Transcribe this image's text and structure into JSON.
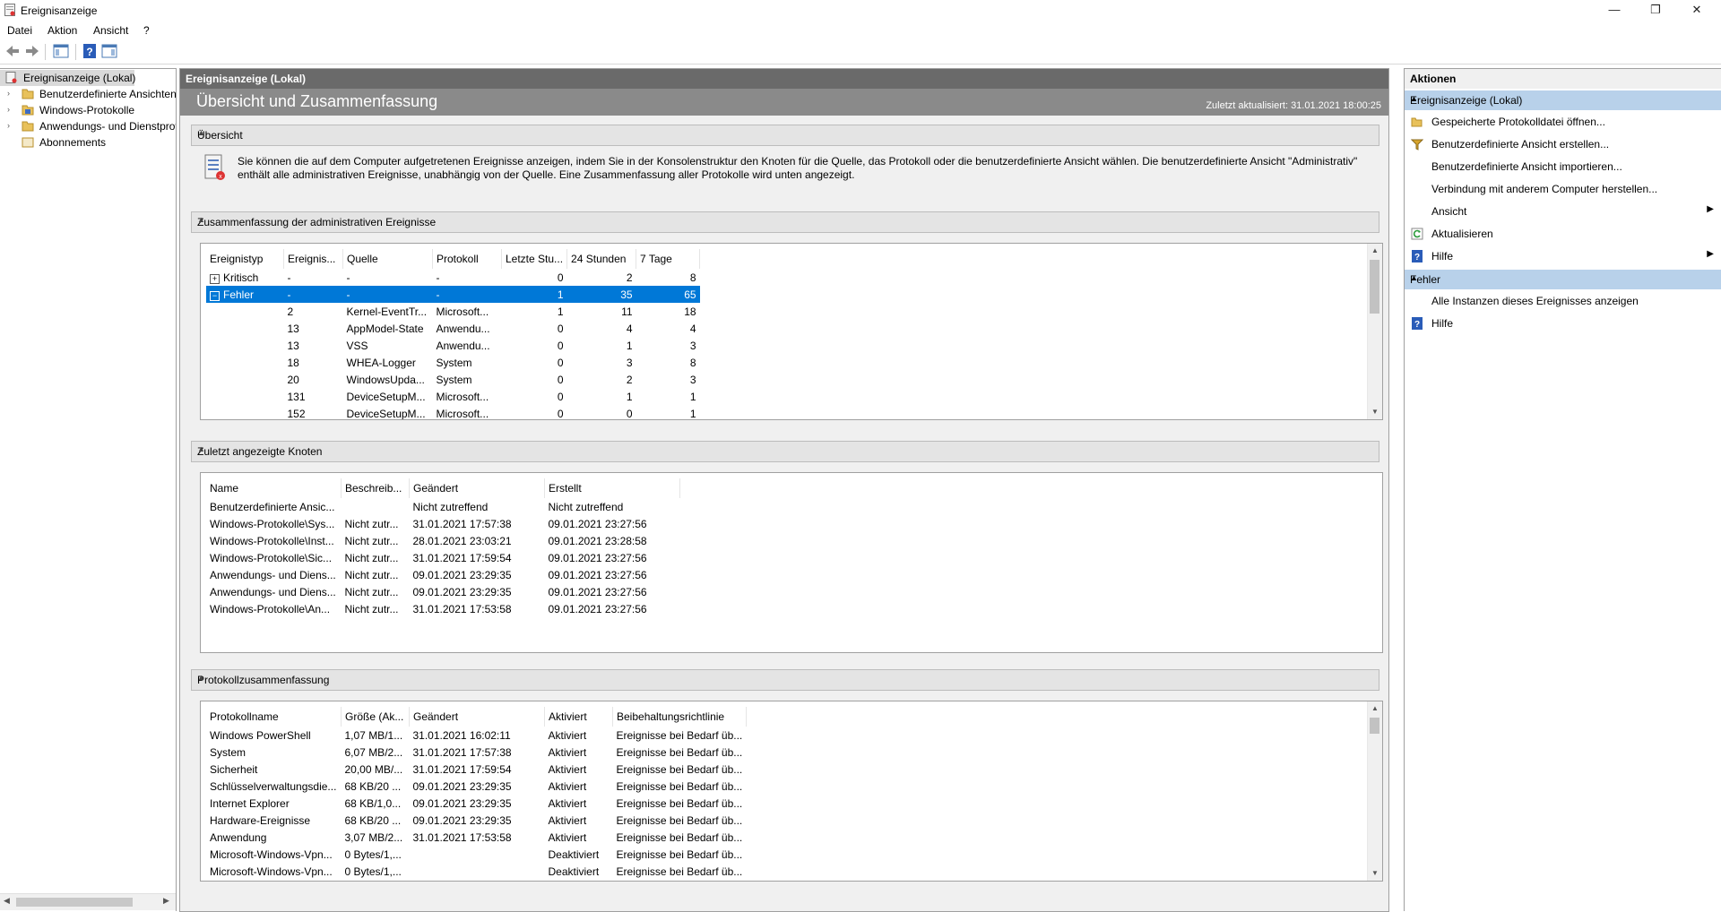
{
  "window": {
    "title": "Ereignisanzeige",
    "minimize": "—",
    "maximize": "❐",
    "close": "✕"
  },
  "menu": [
    "Datei",
    "Aktion",
    "Ansicht",
    "?"
  ],
  "toolbar": {
    "icons": [
      "back-arrow-icon",
      "forward-arrow-icon",
      "show-hide-tree-icon",
      "help-icon",
      "show-hide-action-pane-icon"
    ]
  },
  "tree": {
    "items": [
      {
        "label": "Ereignisanzeige (Lokal)",
        "icon": "event-viewer-icon",
        "expander": ""
      },
      {
        "label": "Benutzerdefinierte Ansichten",
        "icon": "folder-icon",
        "expander": "›"
      },
      {
        "label": "Windows-Protokolle",
        "icon": "folder-icon",
        "expander": "›"
      },
      {
        "label": "Anwendungs- und Dienstprotokolle",
        "icon": "folder-icon",
        "expander": "›"
      },
      {
        "label": "Abonnements",
        "icon": "subscriptions-icon",
        "expander": ""
      }
    ]
  },
  "center": {
    "header": "Ereignisanzeige (Lokal)",
    "title": "Übersicht und Zusammenfassung",
    "updated": "Zuletzt aktualisiert: 31.01.2021 18:00:25",
    "overview": {
      "heading": "Übersicht",
      "text": "Sie können die auf dem Computer aufgetretenen Ereignisse anzeigen, indem Sie in der Konsolenstruktur den Knoten für die Quelle, das Protokoll oder die benutzerdefinierte Ansicht wählen. Die benutzerdefinierte Ansicht \"Administrativ\" enthält alle administrativen Ereignisse, unabhängig von der Quelle. Eine Zusammenfassung aller Protokolle wird unten angezeigt."
    },
    "admin_summary": {
      "heading": "Zusammenfassung der administrativen Ereignisse",
      "columns": [
        "Ereignistyp",
        "Ereignis...",
        "Quelle",
        "Protokoll",
        "Letzte Stu...",
        "24 Stunden",
        "7 Tage"
      ],
      "rows": [
        [
          "Kritisch",
          "-",
          "-",
          "-",
          "0",
          "2",
          "8"
        ],
        [
          "Fehler",
          "-",
          "-",
          "-",
          "1",
          "35",
          "65"
        ],
        [
          "",
          "2",
          "Kernel-EventTr...",
          "Microsoft...",
          "1",
          "11",
          "18"
        ],
        [
          "",
          "13",
          "AppModel-State",
          "Anwendu...",
          "0",
          "4",
          "4"
        ],
        [
          "",
          "13",
          "VSS",
          "Anwendu...",
          "0",
          "1",
          "3"
        ],
        [
          "",
          "18",
          "WHEA-Logger",
          "System",
          "0",
          "3",
          "8"
        ],
        [
          "",
          "20",
          "WindowsUpda...",
          "System",
          "0",
          "2",
          "3"
        ],
        [
          "",
          "131",
          "DeviceSetupM...",
          "Microsoft...",
          "0",
          "1",
          "1"
        ],
        [
          "",
          "152",
          "DeviceSetupM...",
          "Microsoft...",
          "0",
          "0",
          "1"
        ]
      ]
    },
    "recent_nodes": {
      "heading": "Zuletzt angezeigte Knoten",
      "columns": [
        "Name",
        "Beschreib...",
        "Geändert",
        "Erstellt"
      ],
      "rows": [
        [
          "Benutzerdefinierte Ansic...",
          "",
          "Nicht zutreffend",
          "Nicht zutreffend"
        ],
        [
          "Windows-Protokolle\\Sys...",
          "Nicht zutr...",
          "31.01.2021 17:57:38",
          "09.01.2021 23:27:56"
        ],
        [
          "Windows-Protokolle\\Inst...",
          "Nicht zutr...",
          "28.01.2021 23:03:21",
          "09.01.2021 23:28:58"
        ],
        [
          "Windows-Protokolle\\Sic...",
          "Nicht zutr...",
          "31.01.2021 17:59:54",
          "09.01.2021 23:27:56"
        ],
        [
          "Anwendungs- und Diens...",
          "Nicht zutr...",
          "09.01.2021 23:29:35",
          "09.01.2021 23:27:56"
        ],
        [
          "Anwendungs- und Diens...",
          "Nicht zutr...",
          "09.01.2021 23:29:35",
          "09.01.2021 23:27:56"
        ],
        [
          "Windows-Protokolle\\An...",
          "Nicht zutr...",
          "31.01.2021 17:53:58",
          "09.01.2021 23:27:56"
        ]
      ]
    },
    "log_summary": {
      "heading": "Protokollzusammenfassung",
      "columns": [
        "Protokollname",
        "Größe (Ak...",
        "Geändert",
        "Aktiviert",
        "Beibehaltungsrichtlinie"
      ],
      "rows": [
        [
          "Windows PowerShell",
          "1,07 MB/1...",
          "31.01.2021 16:02:11",
          "Aktiviert",
          "Ereignisse bei Bedarf üb..."
        ],
        [
          "System",
          "6,07 MB/2...",
          "31.01.2021 17:57:38",
          "Aktiviert",
          "Ereignisse bei Bedarf üb..."
        ],
        [
          "Sicherheit",
          "20,00 MB/...",
          "31.01.2021 17:59:54",
          "Aktiviert",
          "Ereignisse bei Bedarf üb..."
        ],
        [
          "Schlüsselverwaltungsdie...",
          "68 KB/20 ...",
          "09.01.2021 23:29:35",
          "Aktiviert",
          "Ereignisse bei Bedarf üb..."
        ],
        [
          "Internet Explorer",
          "68 KB/1,0...",
          "09.01.2021 23:29:35",
          "Aktiviert",
          "Ereignisse bei Bedarf üb..."
        ],
        [
          "Hardware-Ereignisse",
          "68 KB/20 ...",
          "09.01.2021 23:29:35",
          "Aktiviert",
          "Ereignisse bei Bedarf üb..."
        ],
        [
          "Anwendung",
          "3,07 MB/2...",
          "31.01.2021 17:53:58",
          "Aktiviert",
          "Ereignisse bei Bedarf üb..."
        ],
        [
          "Microsoft-Windows-Vpn...",
          "0 Bytes/1,...",
          "",
          "Deaktiviert",
          "Ereignisse bei Bedarf üb..."
        ],
        [
          "Microsoft-Windows-Vpn...",
          "0 Bytes/1,...",
          "",
          "Deaktiviert",
          "Ereignisse bei Bedarf üb..."
        ]
      ]
    }
  },
  "actions": {
    "title": "Aktionen",
    "group1": "Ereignisanzeige (Lokal)",
    "group1_items": [
      {
        "label": "Gespeicherte Protokolldatei öffnen...",
        "icon": "open-folder-icon",
        "arrow": ""
      },
      {
        "label": "Benutzerdefinierte Ansicht erstellen...",
        "icon": "filter-icon",
        "arrow": ""
      },
      {
        "label": "Benutzerdefinierte Ansicht importieren...",
        "icon": "",
        "arrow": ""
      },
      {
        "label": "Verbindung mit anderem Computer herstellen...",
        "icon": "",
        "arrow": ""
      },
      {
        "label": "Ansicht",
        "icon": "",
        "arrow": "▶"
      },
      {
        "label": "Aktualisieren",
        "icon": "refresh-icon",
        "arrow": ""
      },
      {
        "label": "Hilfe",
        "icon": "help-icon",
        "arrow": "▶"
      }
    ],
    "group2": "Fehler",
    "group2_items": [
      {
        "label": "Alle Instanzen dieses Ereignisses anzeigen",
        "icon": "",
        "arrow": ""
      },
      {
        "label": "Hilfe",
        "icon": "help-icon",
        "arrow": ""
      }
    ]
  }
}
